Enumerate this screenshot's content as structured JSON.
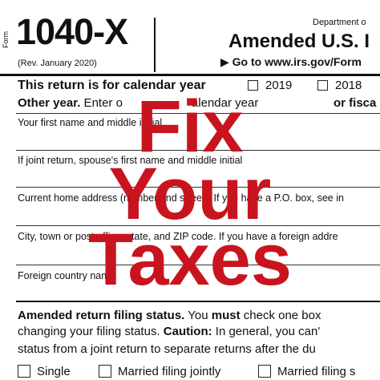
{
  "header": {
    "form_word": "Form",
    "form_number": "1040-X",
    "revision": "(Rev. January 2020)",
    "department": "Department o",
    "title": "Amended U.S. I",
    "goto": "▶ Go to www.irs.gov/Form"
  },
  "calendar": {
    "label": "This return is for calendar year",
    "year_1": "2019",
    "year_2": "2018",
    "other_bold": "Other year.",
    "other_rest": " Enter o",
    "other_end": "alendar year",
    "fiscal": "or fisca"
  },
  "fields": {
    "first_name": "Your first name and middle initial",
    "spouse_name": "If joint return, spouse's first name and middle initial",
    "home_address": "Current home address (number and street). If you have a P.O. box, see in",
    "city": "City, town or post office, state, and ZIP code. If you have a foreign addre",
    "country": "Foreign country nam"
  },
  "filing_status": {
    "heading_bold": "Amended return filing status.",
    "heading_rest": " You ",
    "must": "must",
    "heading_end": " check one box",
    "line2_start": "changing your filing status. ",
    "caution": "Caution:",
    "line2_end": " In general, you can'",
    "line3": "status from a joint return to separate returns after the du",
    "options": [
      "Single",
      "Married filing jointly",
      "Married filing s"
    ]
  },
  "overlay": {
    "line1": "Fix",
    "line2": "Your",
    "line3": "Taxes"
  },
  "colors": {
    "overlay_red": "#c8141e"
  }
}
